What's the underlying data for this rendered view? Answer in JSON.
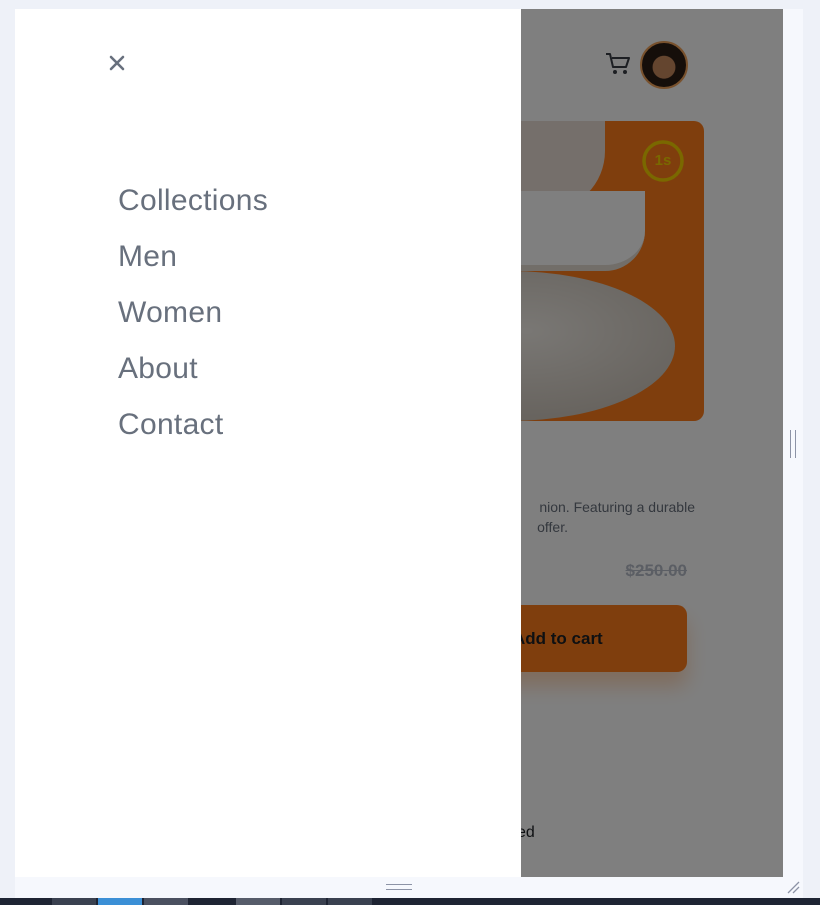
{
  "menu": {
    "close_icon": "close-icon",
    "items": [
      {
        "label": "Collections"
      },
      {
        "label": "Men"
      },
      {
        "label": "Women"
      },
      {
        "label": "About"
      },
      {
        "label": "Contact"
      }
    ]
  },
  "header": {
    "cart_icon": "cart-icon",
    "avatar": "user-avatar"
  },
  "product": {
    "timer_label": "1s",
    "description_line1": "nion. Featuring a durable",
    "description_line2": "offer.",
    "old_price": "$250.00",
    "add_to_cart_label": "Add to cart",
    "footer_fragment": "ed"
  },
  "colors": {
    "accent": "#ff7d1a",
    "menu_text": "#68707d",
    "overlay": "rgba(0,0,0,0.5)"
  }
}
